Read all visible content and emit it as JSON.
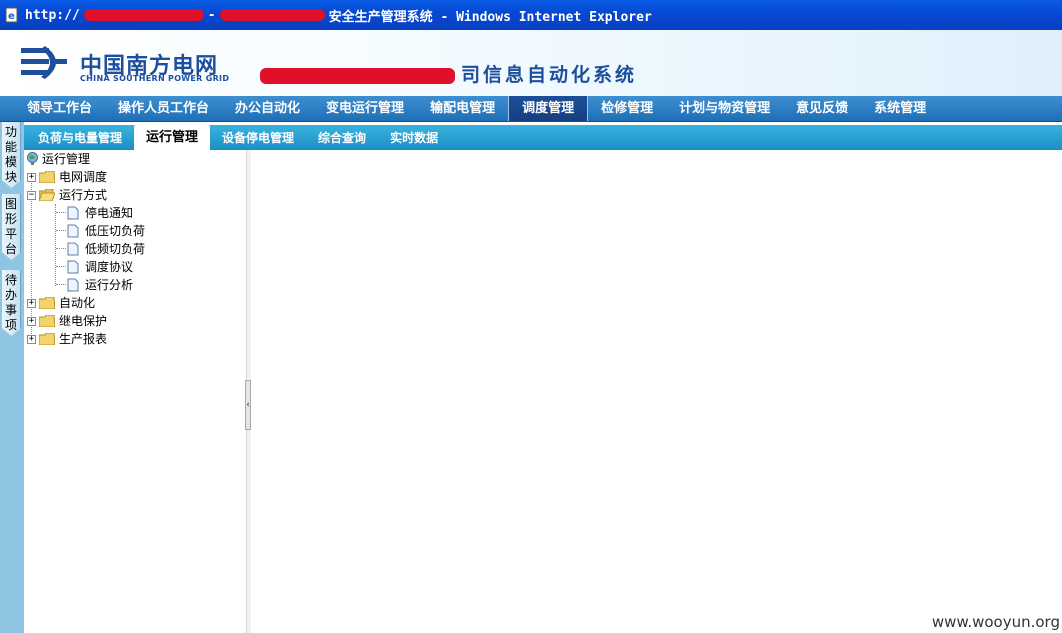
{
  "window": {
    "url_prefix": "http://",
    "title_suffix": "安全生产管理系统 - Windows Internet Explorer"
  },
  "header": {
    "logo_cn": "中国南方电网",
    "logo_en": "CHINA SOUTHERN POWER GRID",
    "system_title": "司信息自动化系统",
    "brand_color": "#1d4f9c"
  },
  "main_nav": [
    {
      "label": "领导工作台"
    },
    {
      "label": "操作人员工作台"
    },
    {
      "label": "办公自动化"
    },
    {
      "label": "变电运行管理"
    },
    {
      "label": "输配电管理"
    },
    {
      "label": "调度管理"
    },
    {
      "label": "检修管理"
    },
    {
      "label": "计划与物资管理"
    },
    {
      "label": "意见反馈"
    },
    {
      "label": "系统管理"
    }
  ],
  "main_nav_active": "调度管理",
  "sub_nav": [
    {
      "label": "负荷与电量管理"
    },
    {
      "label": "运行管理"
    },
    {
      "label": "设备停电管理"
    },
    {
      "label": "综合查询"
    },
    {
      "label": "实时数据"
    }
  ],
  "sub_nav_active": "运行管理",
  "side_tabs": [
    {
      "label": [
        "功",
        "能",
        "模",
        "块"
      ]
    },
    {
      "label": [
        "图",
        "形",
        "平",
        "台"
      ]
    },
    {
      "label": [
        "待",
        "办",
        "事",
        "项"
      ]
    }
  ],
  "tree": {
    "root": "运行管理",
    "items": [
      {
        "label": "电网调度",
        "expanded": false
      },
      {
        "label": "运行方式",
        "expanded": true,
        "children": [
          "停电通知",
          "低压切负荷",
          "低频切负荷",
          "调度协议",
          "运行分析"
        ]
      },
      {
        "label": "自动化",
        "expanded": false
      },
      {
        "label": "继电保护",
        "expanded": false
      },
      {
        "label": "生产报表",
        "expanded": false
      }
    ]
  },
  "icons": {
    "browser": "ie-page-icon",
    "folder": "folder-icon",
    "document": "document-icon",
    "root": "globe-icon"
  },
  "watermark": "www.wooyun.org"
}
